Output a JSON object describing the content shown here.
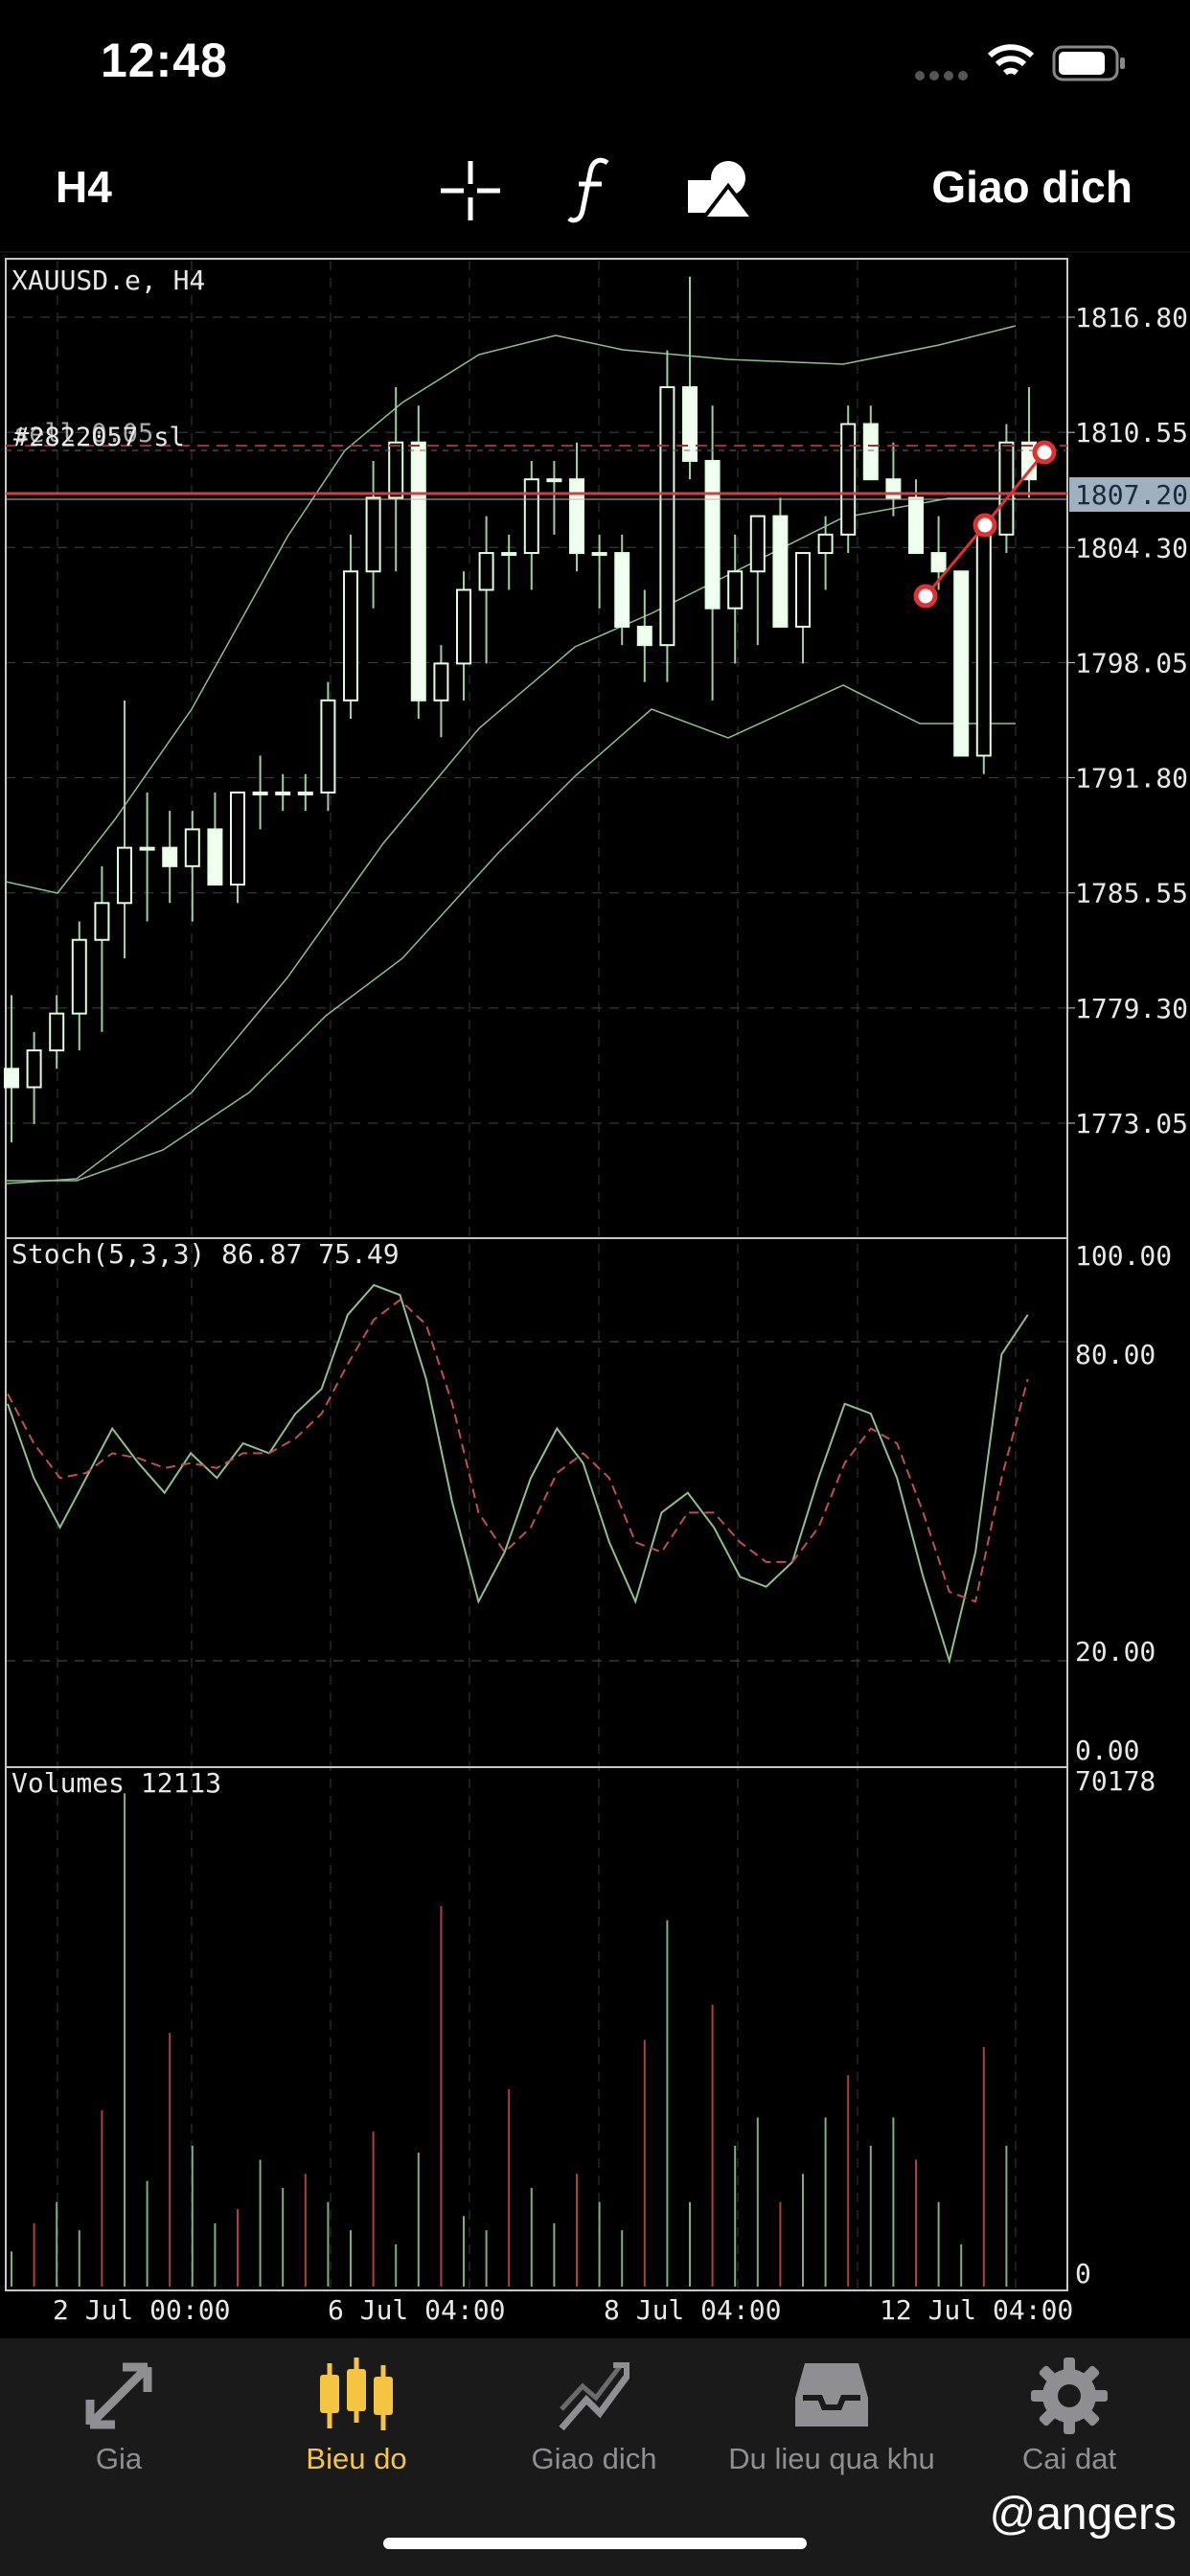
{
  "status_bar": {
    "time": "12:48"
  },
  "toolbar": {
    "timeframe": "H4",
    "icons": [
      "crosshair-icon",
      "function-icon",
      "objects-icon"
    ],
    "trade_label": "Giao dich"
  },
  "chart": {
    "symbol_label": "XAUUSD.e, H4",
    "order_label": "#2822057 sl",
    "order_label_overlay": "sell 0.05",
    "current_price": "1807.20",
    "price_ticks": [
      "1816.80",
      "1810.55",
      "1804.30",
      "1798.05",
      "1791.80",
      "1785.55",
      "1779.30",
      "1773.05"
    ],
    "stoch_label": "Stoch(5,3,3) 86.87 75.49",
    "stoch_ticks": [
      "100.00",
      "80.00",
      "20.00",
      "0.00"
    ],
    "volume_label": "Volumes 12113",
    "volume_ticks": [
      "70178",
      "0"
    ],
    "time_ticks": [
      "2 Jul 00:00",
      "6 Jul 04:00",
      "8 Jul 04:00",
      "12 Jul 04:00"
    ],
    "colors": {
      "bull": "#f0fff0",
      "bear": "#f0fff0",
      "band": "#8fbf8f",
      "stoch_main": "#8fbf8f",
      "stoch_signal": "#c05050",
      "order_line": "#d04040",
      "current_price_bg": "#9fb0c0"
    }
  },
  "tabs": [
    {
      "label": "Gia",
      "icon": "price-arrows-icon"
    },
    {
      "label": "Bieu do",
      "icon": "candles-icon"
    },
    {
      "label": "Giao dich",
      "icon": "trend-icon"
    },
    {
      "label": "Du lieu qua khu",
      "icon": "inbox-icon"
    },
    {
      "label": "Cai dat",
      "icon": "gear-icon"
    }
  ],
  "watermark": "@angers"
}
